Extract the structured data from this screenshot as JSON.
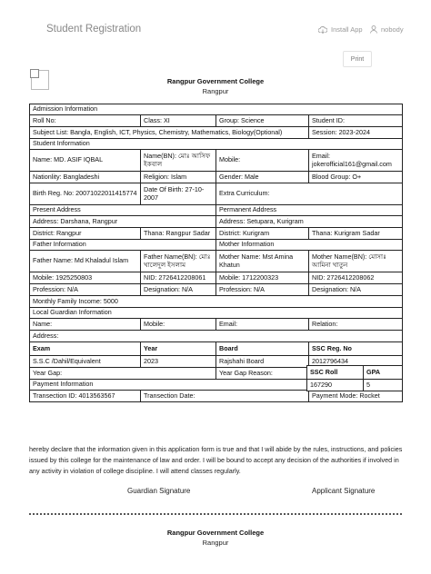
{
  "header": {
    "app_title": "Student Registration",
    "install_label": "Install App",
    "user_label": "nobody",
    "print_label": "Print"
  },
  "college": {
    "name": "Rangpur Government College",
    "city": "Rangpur"
  },
  "admission": {
    "section": "Admission Information",
    "roll": "Roll No:",
    "class": "Class: XI",
    "group": "Group: Science",
    "student_id": "Student ID:",
    "subjects": "Subject List: Bangla, English, ICT, Physics, Chemistry, Mathematics, Biology(Optional)",
    "session": "Session: 2023-2024"
  },
  "student": {
    "section": "Student Information",
    "name": "Name: MD. ASIF IQBAL",
    "name_bn": "Name(BN): মোঃ আসিফ ইকবাল",
    "mobile": "Mobile:",
    "email": "Email: jokerofficial161@gmail.com",
    "nationality": "Nationlity: Bangladeshi",
    "religion": "Religion: Islam",
    "gender": "Gender: Male",
    "blood": "Blood Group: O+",
    "birth_reg": "Birth Reg. No: 20071022011415774",
    "dob": "Date Of Birth: 27-10-2007",
    "extra": "Extra Curriculum:"
  },
  "address": {
    "present_title": "Present Address",
    "permanent_title": "Permanent Address",
    "present_addr": "Address: Darshana, Rangpur",
    "permanent_addr": "Address: Setupara, Kurigram",
    "present_district": "District: Rangpur",
    "present_thana": "Thana: Rangpur Sadar",
    "permanent_district": "District: Kurigram",
    "permanent_thana": "Thana: Kurigram Sadar"
  },
  "parents": {
    "father_title": "Father Information",
    "mother_title": "Mother Information",
    "father_name": "Father Name: Md Khaladul Islam",
    "father_name_bn": "Father Name(BN): মোঃ খালেদুল ইসলাম",
    "mother_name": "Mother Name: Mst Amina Khatun",
    "mother_name_bn": "Mother Name(BN): মোসাঃ আমিনা খাতুন",
    "father_mobile": "Mobile: 1925250803",
    "father_nid": "NID: 2726412208061",
    "mother_mobile": "Mobile: 1712200323",
    "mother_nid": "NID: 2726412208062",
    "father_profession": "Profession: N/A",
    "father_designation": "Designation: N/A",
    "mother_profession": "Profession: N/A",
    "mother_designation": "Designation: N/A",
    "income": "Monthly Family Income: 5000"
  },
  "guardian": {
    "section": "Local Guardian Information",
    "name": "Name:",
    "mobile": "Mobile:",
    "email": "Email:",
    "relation": "Relation:",
    "address": "Address:"
  },
  "exam": {
    "headers": [
      "Exam",
      "Year",
      "Board",
      "SSC Reg. No",
      "SSC Roll",
      "GPA"
    ],
    "row": [
      "S.S.C /Dahil/Equivalent",
      "2023",
      "Rajshahi Board",
      "2012796434",
      "167290",
      "5"
    ],
    "year_gap": "Year Gap:",
    "year_gap_reason": "Year Gap Reason:"
  },
  "payment": {
    "section": "Payment Information",
    "transaction_id": "Transection ID: 4013563567",
    "transaction_date": "Transection Date:",
    "mode": "Payment Mode: Rocket"
  },
  "declaration": "hereby declare that the information given in this application form is true and that I will abide by the rules, instructions, and policies issued by this college for the maintenance of law and order. I will be bound to accept any decision of the authorities if involved in any activity in violation of college discipline. I will attend classes regularly.",
  "signatures": {
    "guardian": "Guardian Signature",
    "applicant": "Applicant Signature"
  }
}
